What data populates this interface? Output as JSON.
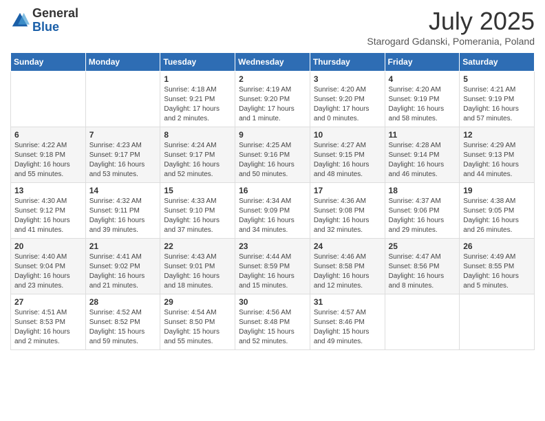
{
  "logo": {
    "general": "General",
    "blue": "Blue"
  },
  "title": "July 2025",
  "subtitle": "Starogard Gdanski, Pomerania, Poland",
  "days_of_week": [
    "Sunday",
    "Monday",
    "Tuesday",
    "Wednesday",
    "Thursday",
    "Friday",
    "Saturday"
  ],
  "weeks": [
    [
      {
        "day": "",
        "info": ""
      },
      {
        "day": "",
        "info": ""
      },
      {
        "day": "1",
        "info": "Sunrise: 4:18 AM\nSunset: 9:21 PM\nDaylight: 17 hours\nand 2 minutes."
      },
      {
        "day": "2",
        "info": "Sunrise: 4:19 AM\nSunset: 9:20 PM\nDaylight: 17 hours\nand 1 minute."
      },
      {
        "day": "3",
        "info": "Sunrise: 4:20 AM\nSunset: 9:20 PM\nDaylight: 17 hours\nand 0 minutes."
      },
      {
        "day": "4",
        "info": "Sunrise: 4:20 AM\nSunset: 9:19 PM\nDaylight: 16 hours\nand 58 minutes."
      },
      {
        "day": "5",
        "info": "Sunrise: 4:21 AM\nSunset: 9:19 PM\nDaylight: 16 hours\nand 57 minutes."
      }
    ],
    [
      {
        "day": "6",
        "info": "Sunrise: 4:22 AM\nSunset: 9:18 PM\nDaylight: 16 hours\nand 55 minutes."
      },
      {
        "day": "7",
        "info": "Sunrise: 4:23 AM\nSunset: 9:17 PM\nDaylight: 16 hours\nand 53 minutes."
      },
      {
        "day": "8",
        "info": "Sunrise: 4:24 AM\nSunset: 9:17 PM\nDaylight: 16 hours\nand 52 minutes."
      },
      {
        "day": "9",
        "info": "Sunrise: 4:25 AM\nSunset: 9:16 PM\nDaylight: 16 hours\nand 50 minutes."
      },
      {
        "day": "10",
        "info": "Sunrise: 4:27 AM\nSunset: 9:15 PM\nDaylight: 16 hours\nand 48 minutes."
      },
      {
        "day": "11",
        "info": "Sunrise: 4:28 AM\nSunset: 9:14 PM\nDaylight: 16 hours\nand 46 minutes."
      },
      {
        "day": "12",
        "info": "Sunrise: 4:29 AM\nSunset: 9:13 PM\nDaylight: 16 hours\nand 44 minutes."
      }
    ],
    [
      {
        "day": "13",
        "info": "Sunrise: 4:30 AM\nSunset: 9:12 PM\nDaylight: 16 hours\nand 41 minutes."
      },
      {
        "day": "14",
        "info": "Sunrise: 4:32 AM\nSunset: 9:11 PM\nDaylight: 16 hours\nand 39 minutes."
      },
      {
        "day": "15",
        "info": "Sunrise: 4:33 AM\nSunset: 9:10 PM\nDaylight: 16 hours\nand 37 minutes."
      },
      {
        "day": "16",
        "info": "Sunrise: 4:34 AM\nSunset: 9:09 PM\nDaylight: 16 hours\nand 34 minutes."
      },
      {
        "day": "17",
        "info": "Sunrise: 4:36 AM\nSunset: 9:08 PM\nDaylight: 16 hours\nand 32 minutes."
      },
      {
        "day": "18",
        "info": "Sunrise: 4:37 AM\nSunset: 9:06 PM\nDaylight: 16 hours\nand 29 minutes."
      },
      {
        "day": "19",
        "info": "Sunrise: 4:38 AM\nSunset: 9:05 PM\nDaylight: 16 hours\nand 26 minutes."
      }
    ],
    [
      {
        "day": "20",
        "info": "Sunrise: 4:40 AM\nSunset: 9:04 PM\nDaylight: 16 hours\nand 23 minutes."
      },
      {
        "day": "21",
        "info": "Sunrise: 4:41 AM\nSunset: 9:02 PM\nDaylight: 16 hours\nand 21 minutes."
      },
      {
        "day": "22",
        "info": "Sunrise: 4:43 AM\nSunset: 9:01 PM\nDaylight: 16 hours\nand 18 minutes."
      },
      {
        "day": "23",
        "info": "Sunrise: 4:44 AM\nSunset: 8:59 PM\nDaylight: 16 hours\nand 15 minutes."
      },
      {
        "day": "24",
        "info": "Sunrise: 4:46 AM\nSunset: 8:58 PM\nDaylight: 16 hours\nand 12 minutes."
      },
      {
        "day": "25",
        "info": "Sunrise: 4:47 AM\nSunset: 8:56 PM\nDaylight: 16 hours\nand 8 minutes."
      },
      {
        "day": "26",
        "info": "Sunrise: 4:49 AM\nSunset: 8:55 PM\nDaylight: 16 hours\nand 5 minutes."
      }
    ],
    [
      {
        "day": "27",
        "info": "Sunrise: 4:51 AM\nSunset: 8:53 PM\nDaylight: 16 hours\nand 2 minutes."
      },
      {
        "day": "28",
        "info": "Sunrise: 4:52 AM\nSunset: 8:52 PM\nDaylight: 15 hours\nand 59 minutes."
      },
      {
        "day": "29",
        "info": "Sunrise: 4:54 AM\nSunset: 8:50 PM\nDaylight: 15 hours\nand 55 minutes."
      },
      {
        "day": "30",
        "info": "Sunrise: 4:56 AM\nSunset: 8:48 PM\nDaylight: 15 hours\nand 52 minutes."
      },
      {
        "day": "31",
        "info": "Sunrise: 4:57 AM\nSunset: 8:46 PM\nDaylight: 15 hours\nand 49 minutes."
      },
      {
        "day": "",
        "info": ""
      },
      {
        "day": "",
        "info": ""
      }
    ]
  ]
}
